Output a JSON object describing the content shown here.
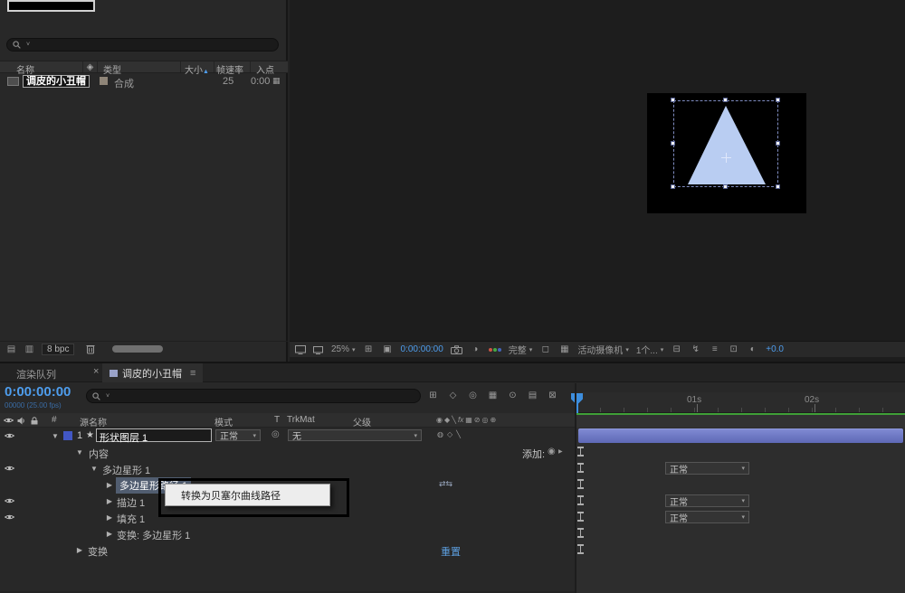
{
  "glyphs": {
    "search_caret": "˅",
    "caret": "▾",
    "exp_open": "▼",
    "exp_closed": "▶",
    "star": "★",
    "close": "×",
    "menu": "≡",
    "pickwhip": "◎",
    "add_bullet": "◉",
    "swap": "⇄⇆",
    "tag": "◈",
    "sort_up": "▲",
    "grid": "▦",
    "panel_a": "▤",
    "panel_b": "▥",
    "gridbox": "⊞",
    "maskbox": "▣",
    "halfcircle": "◑",
    "halfcircle2": "◐",
    "region": "◻",
    "checker": "▦",
    "par": "⊟",
    "bolt": "↯",
    "tl_lines": "≡",
    "flow": "⊡"
  },
  "project_panel": {
    "columns": {
      "name": "名称",
      "type": "类型",
      "size": "大小",
      "framerate": "帧速率",
      "in_point": "入点"
    },
    "item": {
      "name": "调皮的小丑帽",
      "type": "合成",
      "framerate": "25",
      "in_point": "0:00"
    },
    "footer": {
      "bpc": "8 bpc"
    }
  },
  "viewer": {
    "zoom": "25%",
    "time": "0:00:00:00",
    "view_layout": "完整",
    "camera": "活动摄像机",
    "view_count": "1个...",
    "exposure": "+0.0"
  },
  "timeline": {
    "tab_render_queue": "渲染队列",
    "tab_comp": "调皮的小丑帽",
    "current_time": "0:00:00:00",
    "frame_info": "00000 (25.00 fps)",
    "columns": {
      "hash": "#",
      "source_name": "源名称",
      "mode": "模式",
      "t": "T",
      "trkmat": "TrkMat",
      "parent": "父级"
    },
    "ruler": {
      "t1": "01s",
      "t2": "02s"
    },
    "switch_icons": [
      "◉",
      "◆",
      "╲",
      "fx",
      "▦",
      "⊘",
      "◎",
      "⊕"
    ],
    "layer_switches": [
      "◍",
      "◇",
      "╲"
    ],
    "toolbar_icons": [
      "⊞",
      "◇",
      "◎",
      "▦",
      "⊙",
      "▤",
      "⊠"
    ],
    "layer": {
      "index": "1",
      "name": "形状图层 1",
      "mode": "正常",
      "parent": "无"
    },
    "add_label": "添加:",
    "reset_label": "重置",
    "rows": [
      {
        "label": "内容"
      },
      {
        "label": "多边星形 1",
        "mode": "正常"
      },
      {
        "label": "多边星形路径 1"
      },
      {
        "label": "描边 1",
        "mode": "正常"
      },
      {
        "label": "填充 1",
        "mode": "正常"
      },
      {
        "label": "变换: 多边星形 1"
      },
      {
        "label": "变换"
      }
    ],
    "context_menu": {
      "item": "转换为贝塞尔曲线路径"
    }
  }
}
